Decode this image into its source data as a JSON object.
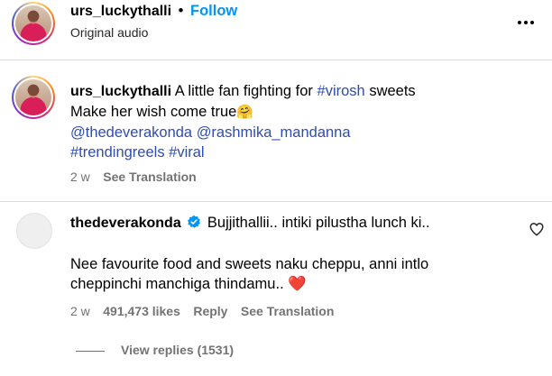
{
  "header": {
    "username": "urs_luckythalli",
    "separator": "•",
    "follow_label": "Follow",
    "subtitle": "Original audio",
    "more_icon": "more-horizontal-icon"
  },
  "caption": {
    "username": "urs_luckythalli",
    "text_line1": "A little fan fighting for",
    "hashtag_virosh": "#virosh",
    "text_line1_end": "sweets",
    "text_line2": "Make her wish come true",
    "emoji": "🤗",
    "mention1": "@thedeverakonda",
    "mention2": "@rashmika_mandanna",
    "hashtag_trending": "#trendingreels",
    "hashtag_viral": "#viral",
    "time": "2 w",
    "see_translation": "See Translation"
  },
  "comment": {
    "username": "thedeverakonda",
    "verified_icon": "verified-badge-icon",
    "line1": "Bujjithallii.. intiki pilustha lunch ki..",
    "line2": "Nee favourite food and sweets naku cheppu, anni intlo",
    "line3": "cheppinchi manchiga thindamu..",
    "heart_emoji": "❤️",
    "time": "2 w",
    "likes": "491,473 likes",
    "reply_label": "Reply",
    "see_translation": "See Translation",
    "view_replies": "View replies (1531)",
    "like_icon": "heart-outline-icon"
  },
  "colors": {
    "link_blue": "#2f4db1",
    "secondary_grey": "#737373",
    "follow_blue": "#0095f6",
    "heart_red": "#ed4956",
    "verified_blue": "#0095f6"
  }
}
